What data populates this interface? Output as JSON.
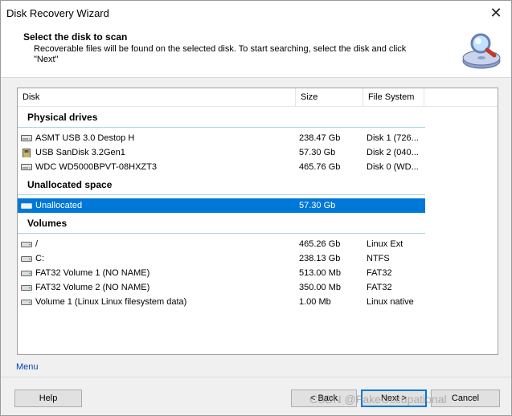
{
  "window": {
    "title": "Disk Recovery Wizard"
  },
  "header": {
    "title": "Select the disk to scan",
    "subtitle_line1": "Recoverable files will be found on the selected disk. To start searching, select the disk and click",
    "subtitle_line2": "\"Next\""
  },
  "table": {
    "columns": {
      "disk": "Disk",
      "size": "Size",
      "fs": "File System"
    },
    "groups": {
      "physical": "Physical drives",
      "unallocated": "Unallocated space",
      "volumes": "Volumes"
    },
    "physical": [
      {
        "name": "ASMT USB 3.0 Destop H",
        "size": "238.47 Gb",
        "fs": "Disk 1 (726...",
        "icon": "hard-drive-icon"
      },
      {
        "name": "USB SanDisk 3.2Gen1",
        "size": "57.30 Gb",
        "fs": "Disk 2 (040...",
        "icon": "usb-drive-icon"
      },
      {
        "name": "WDC WD5000BPVT-08HXZT3",
        "size": "465.76 Gb",
        "fs": "Disk 0 (WD...",
        "icon": "hard-drive-icon"
      }
    ],
    "unallocated": [
      {
        "name": "Unallocated",
        "size": "57.30 Gb",
        "fs": "",
        "icon": "unallocated-icon",
        "selected": true
      }
    ],
    "volumes": [
      {
        "name": "/",
        "size": "465.26 Gb",
        "fs": "Linux Ext",
        "icon": "volume-icon"
      },
      {
        "name": "C:",
        "size": "238.13 Gb",
        "fs": "NTFS",
        "icon": "volume-icon"
      },
      {
        "name": "FAT32 Volume 1 (NO NAME)",
        "size": "513.00 Mb",
        "fs": "FAT32",
        "icon": "volume-icon"
      },
      {
        "name": "FAT32 Volume 2 (NO NAME)",
        "size": "350.00 Mb",
        "fs": "FAT32",
        "icon": "volume-icon"
      },
      {
        "name": "Volume 1 (Linux Linux filesystem data)",
        "size": "1.00 Mb",
        "fs": "Linux native",
        "icon": "volume-icon"
      }
    ]
  },
  "menu_link": "Menu",
  "buttons": {
    "help": "Help",
    "back": "< Back",
    "next": "Next >",
    "cancel": "Cancel"
  },
  "watermark": "CSDN @FakeOccupational",
  "colors": {
    "selection": "#0078d7",
    "link": "#0645ad",
    "group_line": "#a9d4e0"
  }
}
